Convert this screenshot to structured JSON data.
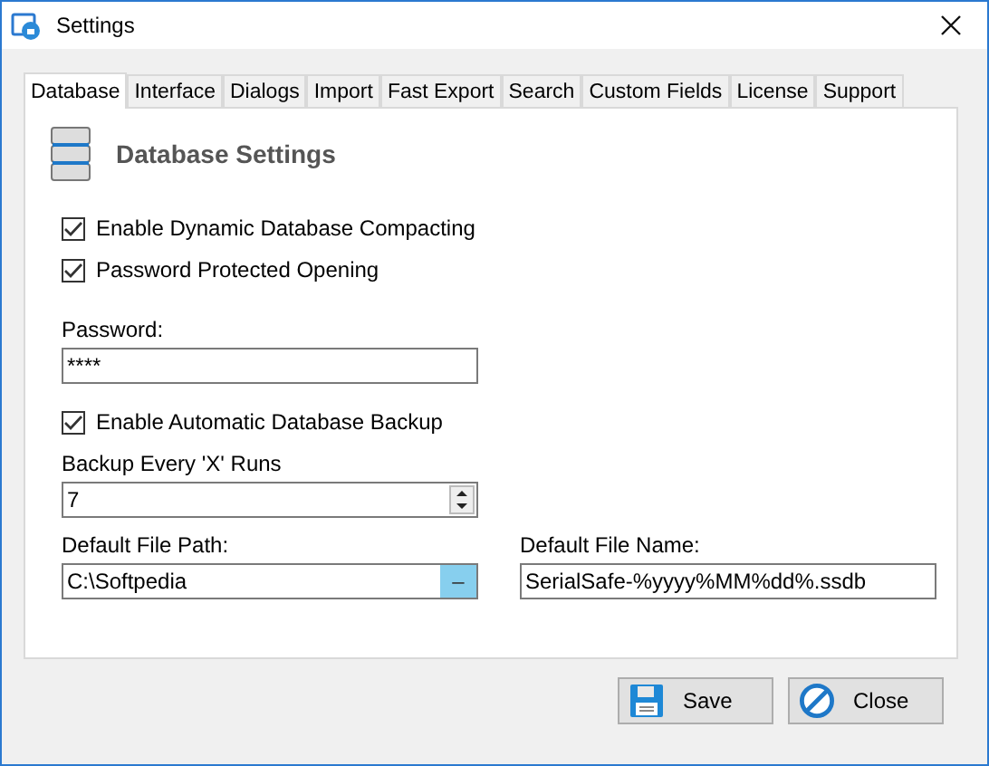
{
  "window": {
    "title": "Settings"
  },
  "tabs": [
    {
      "label": "Database",
      "selected": true
    },
    {
      "label": "Interface",
      "selected": false
    },
    {
      "label": "Dialogs",
      "selected": false
    },
    {
      "label": "Import",
      "selected": false
    },
    {
      "label": "Fast Export",
      "selected": false
    },
    {
      "label": "Search",
      "selected": false
    },
    {
      "label": "Custom Fields",
      "selected": false
    },
    {
      "label": "License",
      "selected": false
    },
    {
      "label": "Support",
      "selected": false
    }
  ],
  "heading": "Database Settings",
  "options": [
    {
      "label": "Enable Dynamic Database Compacting",
      "checked": true
    },
    {
      "label": "Password Protected Opening",
      "checked": true
    }
  ],
  "password": {
    "label": "Password:",
    "value": "****"
  },
  "backup": {
    "label": "Enable Automatic Database Backup",
    "checked": true
  },
  "backup_runs": {
    "label": "Backup Every 'X' Runs",
    "value": "7"
  },
  "file_path": {
    "label": "Default File Path:",
    "value": "C:\\Softpedia",
    "browse": "–"
  },
  "file_name": {
    "label": "Default File Name:",
    "value": "SerialSafe-%yyyy%MM%dd%.ssdb"
  },
  "buttons": [
    {
      "label": "Save",
      "kind": "save"
    },
    {
      "label": "Close",
      "kind": "close"
    }
  ]
}
